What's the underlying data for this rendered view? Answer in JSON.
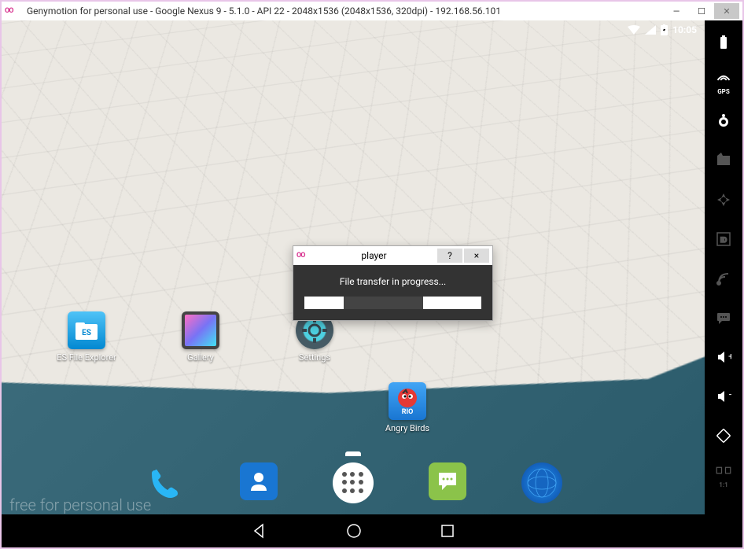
{
  "window": {
    "title": "Genymotion for personal use - Google Nexus 9 - 5.1.0 - API 22 - 2048x1536 (2048x1536, 320dpi) - 192.168.56.101"
  },
  "statusbar": {
    "time": "10:05"
  },
  "apps": {
    "es": "ES File Explorer",
    "gallery": "Gallery",
    "settings": "Settings",
    "angrybirds": "Angry Birds"
  },
  "watermark": "free for personal use",
  "dialog": {
    "title": "player",
    "message": "File transfer in progress...",
    "help": "?",
    "close": "×",
    "progress_percent": 45
  },
  "sidebar": {
    "gps": "GPS",
    "ratio": "1:1"
  }
}
